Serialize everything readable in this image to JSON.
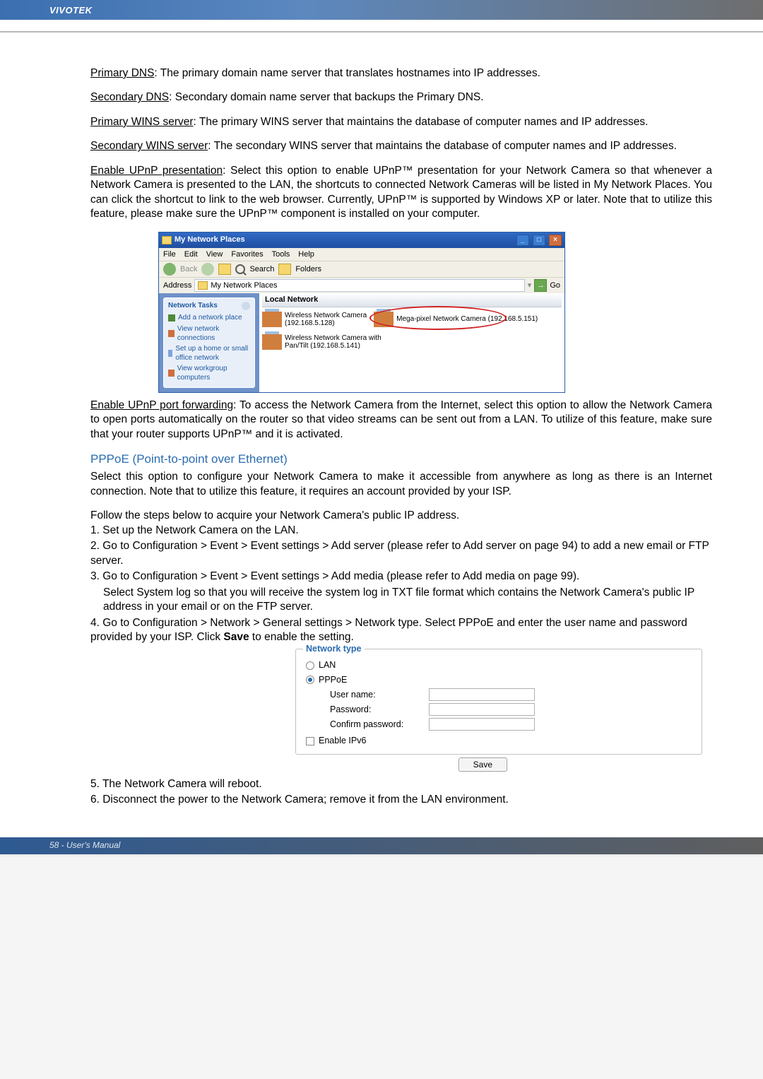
{
  "header": {
    "brand": "VIVOTEK"
  },
  "definitions": {
    "primaryDnsLabel": "Primary DNS",
    "primaryDnsText": ": The primary domain name server that translates hostnames into IP addresses.",
    "secondaryDnsLabel": "Secondary DNS",
    "secondaryDnsText": ": Secondary domain name server that backups the Primary DNS.",
    "primaryWinsLabel": "Primary WINS server",
    "primaryWinsText": ": The primary WINS server that maintains the database of computer names and IP addresses.",
    "secondaryWinsLabel": "Secondary WINS server",
    "secondaryWinsText": ": The secondary WINS server that maintains the database of computer names and IP addresses.",
    "upnpPresLabel": "Enable UPnP presentation",
    "upnpPresText": ": Select this option to enable UPnP™ presentation for your Network Camera so that whenever a Network Camera is presented to the LAN, the shortcuts to connected Network Cameras will be listed in My Network Places. You can click the shortcut to link to the web browser. Currently, UPnP™ is supported by Windows XP or later. Note that to utilize this feature, please make sure the UPnP™ component is installed on your computer.",
    "upnpFwdLabel": "Enable UPnP port forwarding",
    "upnpFwdText": ": To access the Network Camera from the Internet, select this option to allow the Network Camera to open ports automatically on the router so that video streams can be sent out from a LAN. To utilize of this feature, make sure that your router supports UPnP™ and it is activated."
  },
  "window": {
    "title": "My Network Places",
    "menus": [
      "File",
      "Edit",
      "View",
      "Favorites",
      "Tools",
      "Help"
    ],
    "toolbar": {
      "back": "Back",
      "search": "Search",
      "folders": "Folders"
    },
    "addressLabel": "Address",
    "addressValue": "My Network Places",
    "go": "Go",
    "localNetworkHeader": "Local Network",
    "sidePanel": {
      "header": "Network Tasks",
      "addPlace": "Add a network place",
      "viewConn": "View network connections",
      "setupHome": "Set up a home or small office network",
      "viewWorkgroup": "View workgroup computers"
    },
    "cameras": {
      "wireless": {
        "name": "Wireless Network Camera",
        "ip": "(192.168.5.128)"
      },
      "megapixel": "Mega-pixel Network Camera (192.168.5.151)",
      "wirelessPT": {
        "name": "Wireless Network Camera with",
        "detail": "Pan/Tilt (192.168.5.141)"
      }
    }
  },
  "pppoe": {
    "heading": "PPPoE (Point-to-point over Ethernet)",
    "intro": "Select this option to configure your Network Camera to make it accessible from anywhere as long as there is an Internet connection. Note that to utilize this feature, it requires an account provided by your ISP.",
    "lead": "Follow the steps below to acquire your Network Camera's public IP address.",
    "s1": "1. Set up the Network Camera on the LAN.",
    "s2": "2. Go to Configuration > Event > Event settings > Add server (please refer to Add server on page 94) to add a new email or FTP server.",
    "s3": "3. Go to Configuration > Event > Event settings > Add media (please refer to Add media on page 99).",
    "s3a": "Select System log so that you will receive the system log in TXT file format which contains the Network Camera's public IP address in your email or on the FTP server.",
    "s4a": "4. Go to Configuration > Network > General settings > Network type. Select PPPoE and enter the user name and password provided by your ISP. Click ",
    "s4b": "Save",
    "s4c": " to enable the setting.",
    "s5": "5. The Network Camera will reboot.",
    "s6": "6. Disconnect the power to the Network Camera; remove it from the LAN environment."
  },
  "netPanel": {
    "legend": "Network type",
    "lan": "LAN",
    "pppoe": "PPPoE",
    "user": "User name:",
    "pass": "Password:",
    "confirm": "Confirm password:",
    "ipv6": "Enable IPv6",
    "save": "Save"
  },
  "footer": {
    "text": "58 - User's Manual"
  }
}
